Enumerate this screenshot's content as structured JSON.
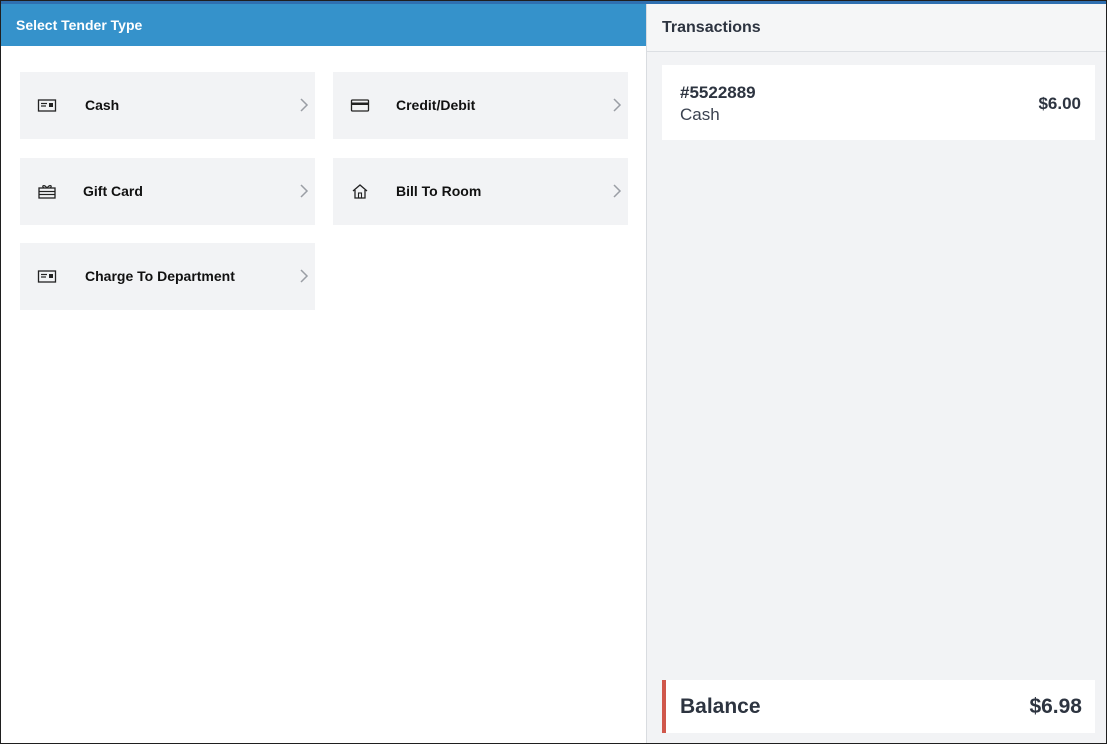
{
  "left_panel": {
    "title": "Select Tender Type",
    "tenders": [
      {
        "label": "Cash",
        "icon": "cash-icon"
      },
      {
        "label": "Credit/Debit",
        "icon": "credit-card-icon"
      },
      {
        "label": "Gift Card",
        "icon": "gift-card-icon"
      },
      {
        "label": "Bill To Room",
        "icon": "home-icon"
      },
      {
        "label": "Charge To Department",
        "icon": "department-card-icon"
      }
    ]
  },
  "right_panel": {
    "title": "Transactions",
    "transactions": [
      {
        "id": "#5522889",
        "type": "Cash",
        "amount": "$6.00"
      }
    ],
    "balance": {
      "label": "Balance",
      "value": "$6.98",
      "accent_color": "#d0574b"
    }
  },
  "colors": {
    "header_blue": "#3592cb",
    "button_bg": "#f2f3f5",
    "panel_bg": "#f2f3f5"
  }
}
